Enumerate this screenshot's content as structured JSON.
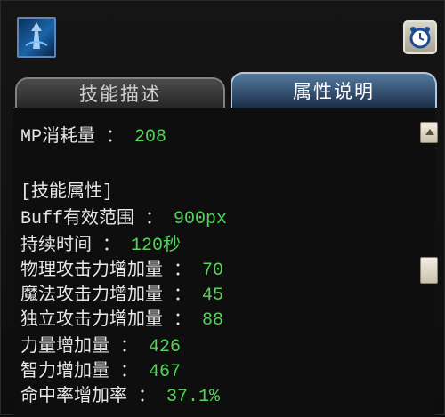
{
  "tabs": {
    "description": "技能描述",
    "attributes": "属性说明"
  },
  "lines": [
    {
      "label": "MP消耗量 ：",
      "value": "208"
    },
    {
      "label": "[技能属性]",
      "value": ""
    },
    {
      "label": "Buff有效范围 ：",
      "value": "900px"
    },
    {
      "label": "持续时间 ：",
      "value": "120秒"
    },
    {
      "label": "物理攻击力增加量 ：",
      "value": "70"
    },
    {
      "label": "魔法攻击力增加量 ：",
      "value": "45"
    },
    {
      "label": "独立攻击力增加量 ：",
      "value": "88"
    },
    {
      "label": "力量增加量 ：",
      "value": "426"
    },
    {
      "label": "智力增加量 ：",
      "value": "467"
    },
    {
      "label": "命中率增加率 ：",
      "value": "37.1%"
    }
  ],
  "icons": {
    "skill": "skill-icon",
    "alarm": "alarm-clock-icon",
    "scroll_up": "scroll-up-arrow-icon"
  }
}
